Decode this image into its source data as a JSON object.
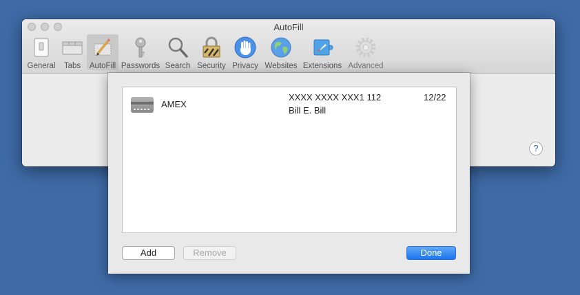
{
  "window": {
    "title": "AutoFill"
  },
  "toolbar": {
    "items": [
      {
        "label": "General",
        "icon": "general-switch-icon"
      },
      {
        "label": "Tabs",
        "icon": "tabs-icon"
      },
      {
        "label": "AutoFill",
        "icon": "autofill-pencil-icon",
        "selected": true
      },
      {
        "label": "Passwords",
        "icon": "key-icon"
      },
      {
        "label": "Search",
        "icon": "magnifier-icon"
      },
      {
        "label": "Security",
        "icon": "padlock-icon"
      },
      {
        "label": "Privacy",
        "icon": "hand-icon"
      },
      {
        "label": "Websites",
        "icon": "globe-icon"
      },
      {
        "label": "Extensions",
        "icon": "puzzle-compass-icon"
      },
      {
        "label": "Advanced",
        "icon": "gear-icon",
        "dimmed": true
      }
    ]
  },
  "help": {
    "label": "?"
  },
  "cards": [
    {
      "name": "AMEX",
      "number": "XXXX XXXX XXX1 112",
      "holder": "Bill E. Bill",
      "expiry": "12/22"
    }
  ],
  "buttons": {
    "add": "Add",
    "remove": "Remove",
    "done": "Done"
  },
  "colors": {
    "desktop": "#3e6aa6",
    "accent": "#1c74ef"
  }
}
